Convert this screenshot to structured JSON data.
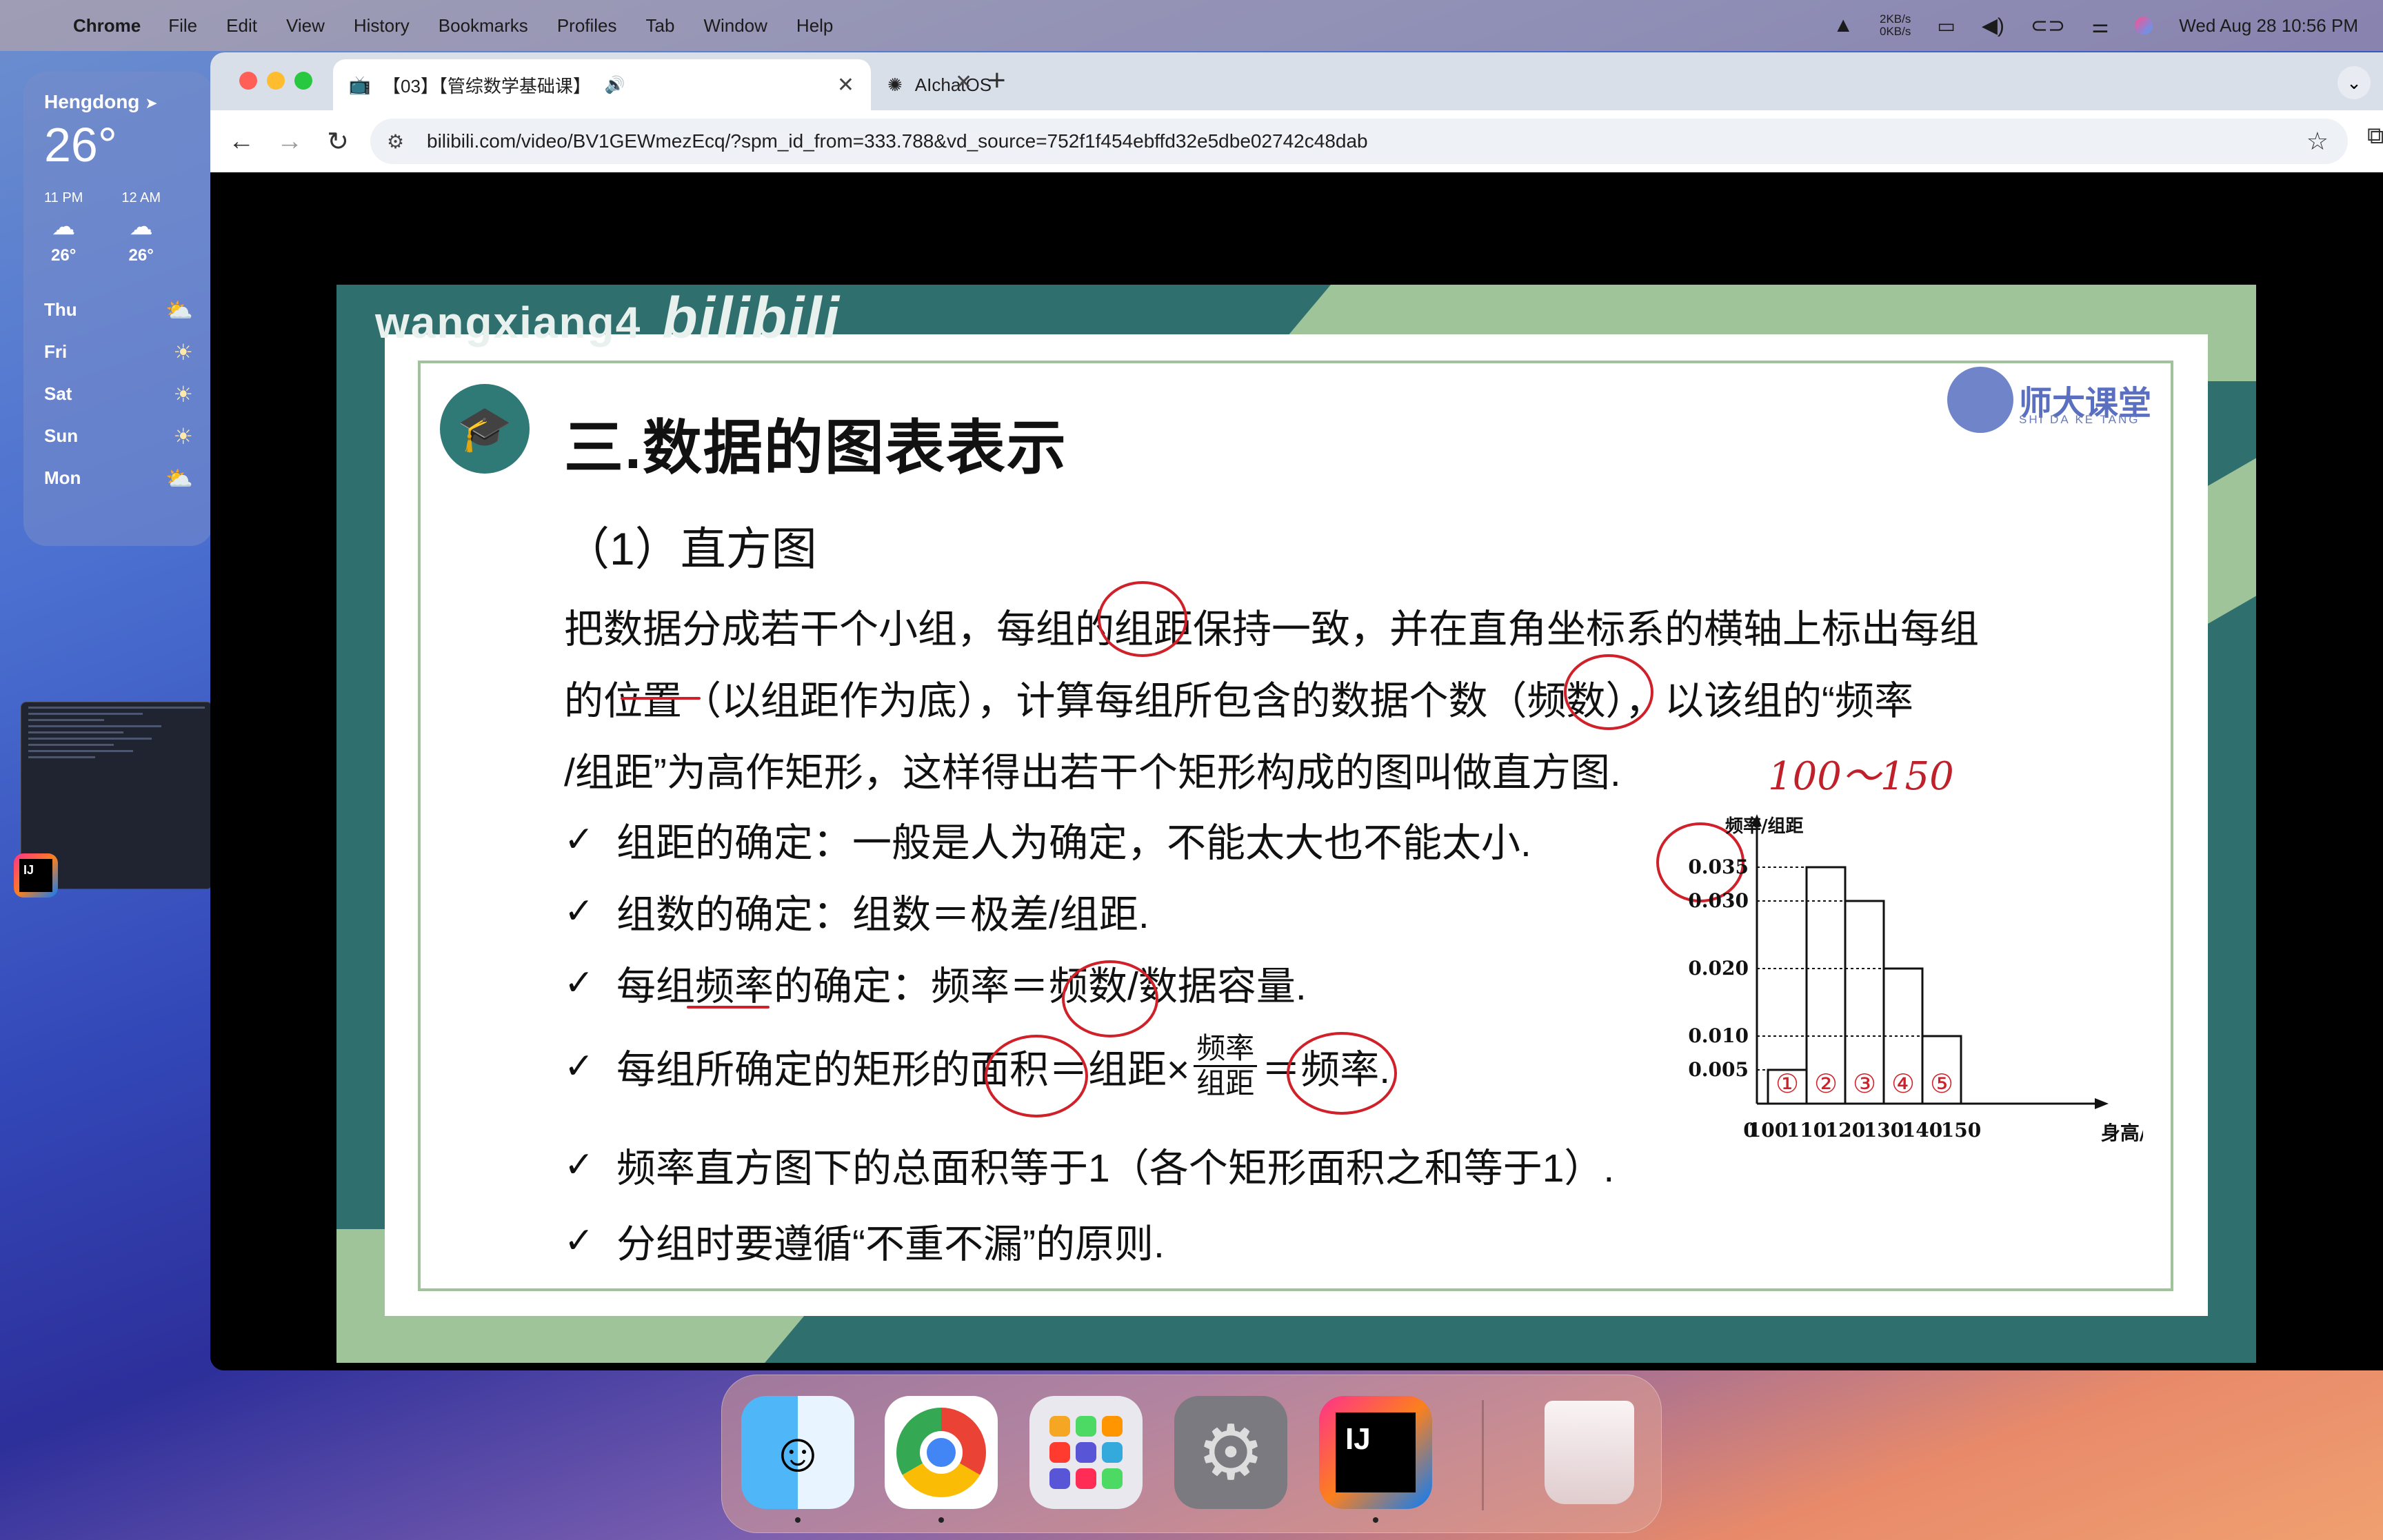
{
  "menubar": {
    "app_name": "Chrome",
    "menus": [
      "File",
      "Edit",
      "View",
      "History",
      "Bookmarks",
      "Profiles",
      "Tab",
      "Window",
      "Help"
    ],
    "net_up": "2KB/s",
    "net_down": "0KB/s",
    "datetime": "Wed Aug 28  10:56 PM"
  },
  "weather": {
    "city": "Hengdong",
    "temp": "26°",
    "hours": [
      {
        "label": "11 PM",
        "temp": "26°"
      },
      {
        "label": "12 AM",
        "temp": "26°"
      }
    ],
    "days": [
      "Thu",
      "Fri",
      "Sat",
      "Sun",
      "Mon"
    ]
  },
  "browser": {
    "tabs": [
      {
        "title": "【03】【管综数学基础课】",
        "active": true
      },
      {
        "title": "AIchatOS",
        "active": false
      }
    ],
    "url": "bilibili.com/video/BV1GEWmezEcq/?spm_id_from=333.788&vd_source=752f1f454ebffd32e5dbe02742c48dab"
  },
  "slide": {
    "watermark": "wangxiang4",
    "watermark_brand": "bilibili",
    "title": "三.数据的图表表示",
    "logo_name": "师大课堂",
    "logo_pinyin": "SHI DA KE TANG",
    "subtitle": "（1）直方图",
    "paragraph": [
      "把数据分成若干个小组，每组的组距保持一致，并在直角坐标系的横轴上标出每组",
      "的位置（以组距作为底），计算每组所包含的数据个数（频数），以该组的“频率",
      "/组距”为高作矩形，这样得出若干个矩形构成的图叫做直方图."
    ],
    "bullets": [
      "组距的确定：一般是人为确定，不能太大也不能太小.",
      "组数的确定：组数＝极差/组距.",
      "每组频率的确定：频率＝频数/数据容量.",
      "每组所确定的矩形的面积＝组距×",
      "频率直方图下的总面积等于1（各个矩形面积之和等于1）.",
      "分组时要遵循“不重不漏”的原则."
    ],
    "area_fraction": {
      "num": "频率",
      "den": "组距"
    },
    "area_tail": "＝频率.",
    "handwritten_range": "100～150",
    "handwritten_numbers": [
      "①",
      "②",
      "③",
      "④",
      "⑤"
    ],
    "annotation_color": "#d0202a"
  },
  "chart_data": {
    "type": "bar",
    "ylabel": "频率/组距",
    "xlabel": "身高/厘米",
    "x_ticks": [
      "0",
      "100",
      "110",
      "120",
      "130",
      "140",
      "150"
    ],
    "y_ticks": [
      "0.005",
      "0.010",
      "0.020",
      "0.030",
      "0.035"
    ],
    "categories": [
      "100-110",
      "110-120",
      "120-130",
      "130-140",
      "140-150"
    ],
    "values": [
      0.005,
      0.035,
      0.03,
      0.02,
      0.01
    ],
    "ylim": [
      0,
      0.04
    ]
  }
}
